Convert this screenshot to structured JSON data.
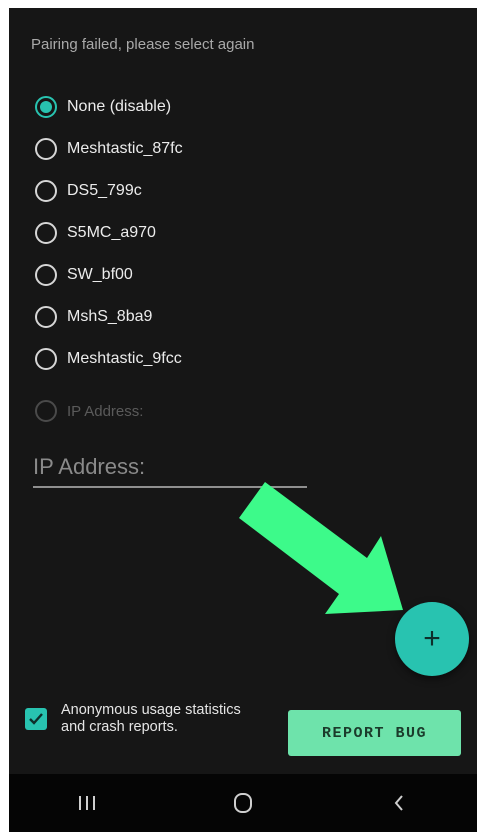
{
  "status_message": "Pairing failed, please select again",
  "devices": [
    {
      "label": "None (disable)",
      "selected": true,
      "enabled": true
    },
    {
      "label": "Meshtastic_87fc",
      "selected": false,
      "enabled": true
    },
    {
      "label": "DS5_799c",
      "selected": false,
      "enabled": true
    },
    {
      "label": "S5MC_a970",
      "selected": false,
      "enabled": true
    },
    {
      "label": "SW_bf00",
      "selected": false,
      "enabled": true
    },
    {
      "label": "MshS_8ba9",
      "selected": false,
      "enabled": true
    },
    {
      "label": "Meshtastic_9fcc",
      "selected": false,
      "enabled": true
    },
    {
      "label": "IP Address:",
      "selected": false,
      "enabled": false
    }
  ],
  "ip_field": {
    "placeholder": "IP Address:",
    "value": ""
  },
  "fab": {
    "label": "+",
    "icon": "plus-icon"
  },
  "annotation": {
    "icon": "green-arrow-icon",
    "color": "#3dfa8a"
  },
  "consent": {
    "checked": true,
    "text": "Anonymous usage statistics and crash reports."
  },
  "report_button": {
    "label": "REPORT BUG"
  },
  "navbar": {
    "recents_icon": "recents-icon",
    "home_icon": "home-icon",
    "back_icon": "back-icon"
  },
  "colors": {
    "accent": "#28c3b0",
    "report": "#6ee3ab",
    "background": "#161616"
  }
}
